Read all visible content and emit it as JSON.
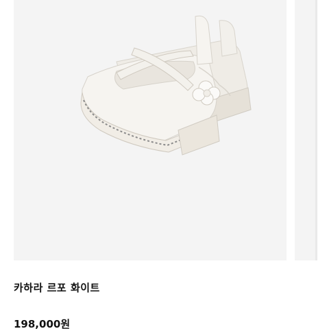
{
  "product": {
    "name": "카하라 르포 화이트",
    "price": "198,000원"
  },
  "colors": {
    "image_background": "#f4f4f4",
    "shoe_body": "#f6f4f0",
    "stitching": "#8a8a8a",
    "price_text": "#111111"
  },
  "image": {
    "icon": "white-mary-jane-shoes-photo"
  }
}
